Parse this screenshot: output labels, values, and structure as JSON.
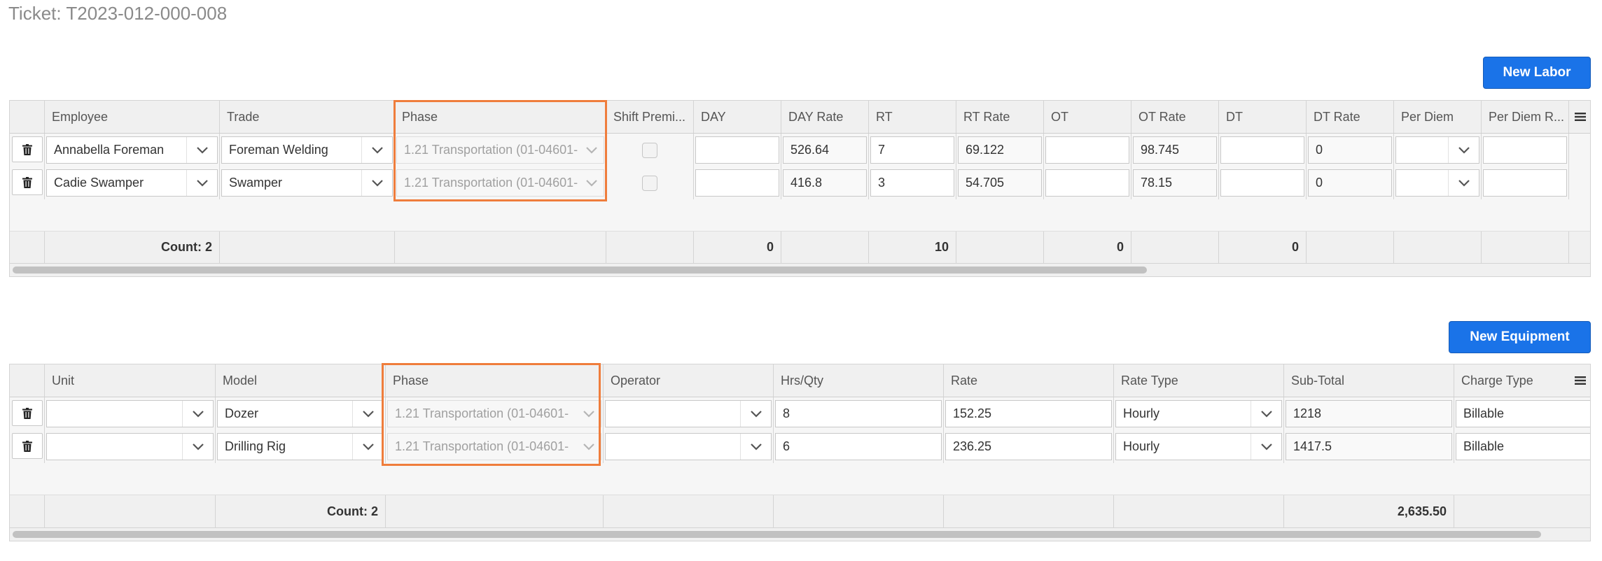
{
  "ticket": {
    "label": "Ticket: T2023-012-000-008"
  },
  "labor": {
    "new_button": "New Labor",
    "columns": [
      "Employee",
      "Trade",
      "Phase",
      "Shift Premi...",
      "DAY",
      "DAY Rate",
      "RT",
      "RT Rate",
      "OT",
      "OT Rate",
      "DT",
      "DT Rate",
      "Per Diem",
      "Per Diem R..."
    ],
    "rows": [
      {
        "employee": "Annabella Foreman",
        "trade": "Foreman Welding",
        "phase": "1.21 Transportation (01-04601-",
        "day": "",
        "day_rate": "526.64",
        "rt": "7",
        "rt_rate": "69.122",
        "ot": "",
        "ot_rate": "98.745",
        "dt": "",
        "dt_rate": "0",
        "per_diem": "",
        "per_diem_rate": ""
      },
      {
        "employee": "Cadie Swamper",
        "trade": "Swamper",
        "phase": "1.21 Transportation (01-04601-",
        "day": "",
        "day_rate": "416.8",
        "rt": "3",
        "rt_rate": "54.705",
        "ot": "",
        "ot_rate": "78.15",
        "dt": "",
        "dt_rate": "0",
        "per_diem": "",
        "per_diem_rate": ""
      }
    ],
    "footer": {
      "count": "Count: 2",
      "day": "0",
      "rt": "10",
      "ot": "0",
      "dt": "0"
    },
    "scroll_fraction": 0.72
  },
  "equipment": {
    "new_button": "New Equipment",
    "columns": [
      "Unit",
      "Model",
      "Phase",
      "Operator",
      "Hrs/Qty",
      "Rate",
      "Rate Type",
      "Sub-Total",
      "Charge Type"
    ],
    "rows": [
      {
        "unit": "",
        "model": "Dozer",
        "phase": "1.21 Transportation (01-04601-",
        "operator": "",
        "hrs": "8",
        "rate": "152.25",
        "rate_type": "Hourly",
        "sub_total": "1218",
        "charge_type": "Billable"
      },
      {
        "unit": "",
        "model": "Drilling Rig",
        "phase": "1.21 Transportation (01-04601-",
        "operator": "",
        "hrs": "6",
        "rate": "236.25",
        "rate_type": "Hourly",
        "sub_total": "1417.5",
        "charge_type": "Billable"
      }
    ],
    "footer": {
      "count": "Count: 2",
      "sub_total": "2,635.50"
    },
    "scroll_fraction": 0.97
  },
  "icons": {
    "delete": "trash-icon",
    "dropdown": "chevron-down-icon",
    "column_menu": "menu-icon"
  },
  "colors": {
    "primary_button": "#1a73e8",
    "highlight": "#ef7d3c"
  }
}
